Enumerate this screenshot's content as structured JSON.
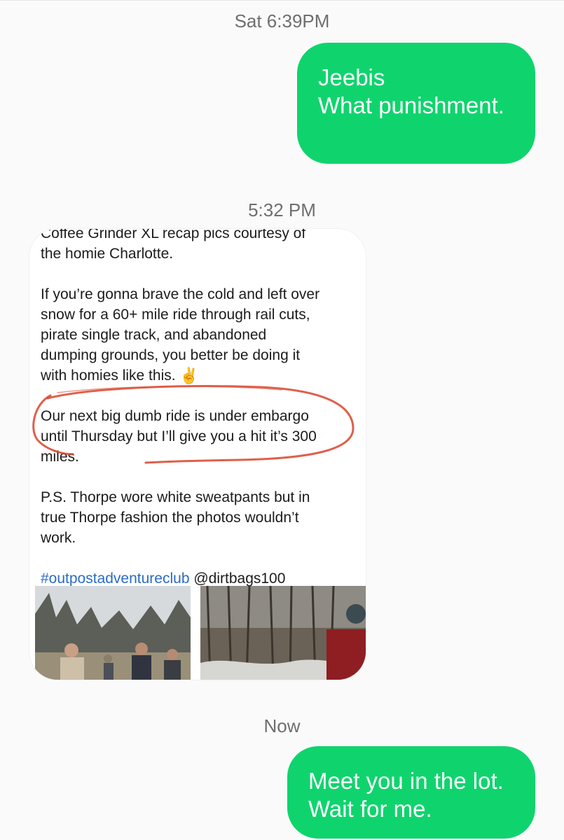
{
  "thread": {
    "timestamp_1": "Sat 6:39PM",
    "message_1": {
      "line_1": "Jeebis",
      "line_2": "What punishment."
    },
    "timestamp_2": "5:32 PM",
    "shared_post": {
      "para_1": {
        "line_1": "Coffee Grinder XL recap pics courtesy of",
        "line_2": "the homie Charlotte."
      },
      "para_2": {
        "line_1": "If you’re gonna brave the cold and left over",
        "line_2": "snow for a 60+ mile ride through rail cuts,",
        "line_3": "pirate single track, and abandoned",
        "line_4": "dumping grounds, you better be doing it",
        "line_5": "with homies like this.",
        "emoji": "✌"
      },
      "para_3": {
        "line_1": "Our next big dumb ride is under embargo",
        "line_2": "until Thursday but I’ll give you a hit it’s 300",
        "line_3": "miles."
      },
      "para_4": {
        "line_1": "P.S. Thorpe wore white sweatpants but in",
        "line_2": "true Thorpe fashion the photos wouldn’t",
        "line_3": "work."
      },
      "hashtag": "#outpostadventureclub",
      "handle": "@dirtbags100"
    },
    "timestamp_3": "Now",
    "message_2": {
      "line_1": "Meet you in the lot.",
      "line_2": "Wait for me."
    }
  },
  "colors": {
    "outgoing_bubble": "#0fd46d",
    "timestamp_text": "#6f6f6f",
    "hashtag": "#2a6cc4",
    "annotation_circle": "#d9442c"
  }
}
